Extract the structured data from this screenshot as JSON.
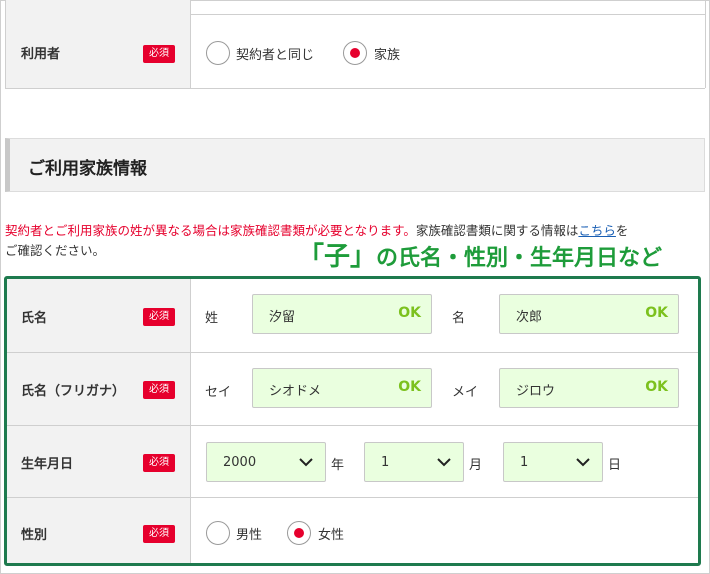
{
  "user_row": {
    "label": "利用者",
    "required": "必須",
    "options": [
      {
        "label": "契約者と同じ",
        "selected": false
      },
      {
        "label": "家族",
        "selected": true
      }
    ]
  },
  "section": {
    "title": "ご利用家族情報"
  },
  "notice": {
    "red_text": "契約者とご利用家族の姓が異なる場合は家族確認書類が必要となります。",
    "text_before_link": "家族確認書類に関する情報は",
    "link_text": "こちら",
    "text_after_link": "を",
    "text_line2": "ご確認ください。"
  },
  "callout": {
    "quoted": "「子」",
    "rest": "の氏名・性別・生年月日など"
  },
  "name_row": {
    "label": "氏名",
    "required": "必須",
    "sei_label": "姓",
    "sei_value": "汐留",
    "mei_label": "名",
    "mei_value": "次郎",
    "ok": "OK"
  },
  "kana_row": {
    "label": "氏名（フリガナ）",
    "required": "必須",
    "sei_label": "セイ",
    "sei_value": "シオドメ",
    "mei_label": "メイ",
    "mei_value": "ジロウ",
    "ok": "OK"
  },
  "birth_row": {
    "label": "生年月日",
    "required": "必須",
    "year_value": "2000",
    "year_unit": "年",
    "month_value": "1",
    "month_unit": "月",
    "day_value": "1",
    "day_unit": "日"
  },
  "gender_row": {
    "label": "性別",
    "required": "必須",
    "options": [
      {
        "label": "男性",
        "selected": false
      },
      {
        "label": "女性",
        "selected": true
      }
    ]
  },
  "colors": {
    "required_badge": "#e6002d",
    "radio_selected": "#e6002d",
    "input_fill": "#eaffdf",
    "ok_text": "#7cc11e",
    "callout_text": "#1e9c3a",
    "highlight_border": "#1e7a4e",
    "notice_red": "#e6002d",
    "link": "#1a5fb4"
  }
}
